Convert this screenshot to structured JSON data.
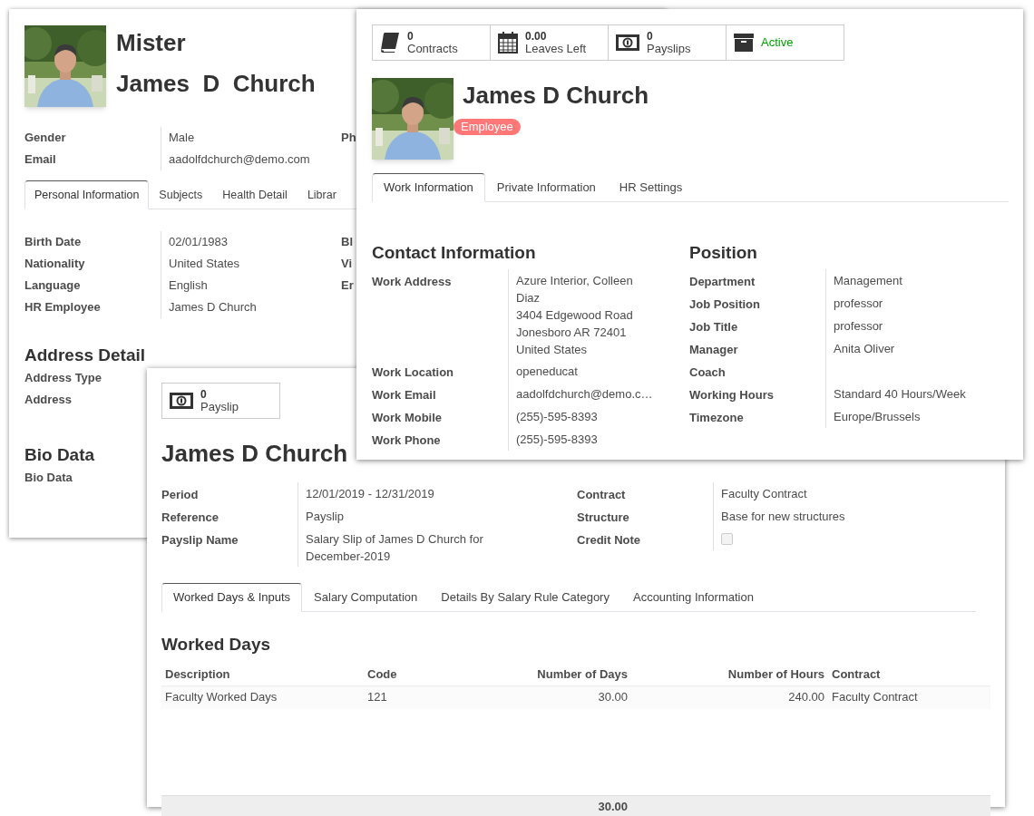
{
  "profile_window": {
    "salutation": "Mister",
    "name": "James  D  Church",
    "fields": [
      {
        "label": "Gender",
        "value": "Male"
      },
      {
        "label": "Email",
        "value": "aadolfdchurch@demo.com"
      }
    ],
    "fields_right": [
      "Ph"
    ],
    "tabs": [
      {
        "label": "Personal Information",
        "selected": true
      },
      {
        "label": "Subjects",
        "selected": false
      },
      {
        "label": "Health Detail",
        "selected": false
      },
      {
        "label": "Librar",
        "selected": false
      }
    ],
    "personal_fields": [
      {
        "label": "Birth Date",
        "value": "02/01/1983"
      },
      {
        "label": "Nationality",
        "value": "United States"
      },
      {
        "label": "Language",
        "value": "English"
      },
      {
        "label": "HR Employee",
        "value": "James D Church"
      }
    ],
    "personal_right": [
      "Bl",
      "Vi",
      "Er"
    ],
    "sections": [
      {
        "title": "Address Detail",
        "fields": [
          "Address Type",
          "Address"
        ]
      },
      {
        "title": "Bio Data",
        "fields": [
          "Bio Data"
        ]
      }
    ]
  },
  "employee_window": {
    "stats": [
      {
        "kind": "book",
        "value": "0",
        "label": "Contracts"
      },
      {
        "kind": "calendar",
        "value": "0.00",
        "label": "Leaves Left"
      },
      {
        "kind": "money",
        "value": "0",
        "label": "Payslips"
      },
      {
        "kind": "archive",
        "label": "Active"
      }
    ],
    "name": "James D Church",
    "badge": "Employee",
    "tabs": [
      {
        "label": "Work Information",
        "selected": true
      },
      {
        "label": "Private Information",
        "selected": false
      },
      {
        "label": "HR Settings",
        "selected": false
      }
    ],
    "contact": {
      "title": "Contact Information",
      "fields": [
        {
          "label": "Work Address",
          "lines": [
            "Azure Interior, Colleen Diaz",
            "3404 Edgewood Road",
            "Jonesboro AR 72401",
            "United States"
          ]
        },
        {
          "label": "Work Location",
          "lines": [
            "openeducat"
          ]
        },
        {
          "label": "Work Email",
          "lines": [
            "aadolfdchurch@demo.c…"
          ]
        },
        {
          "label": "Work Mobile",
          "lines": [
            "(255)-595-8393"
          ]
        },
        {
          "label": "Work Phone",
          "lines": [
            "(255)-595-8393"
          ]
        }
      ]
    },
    "position": {
      "title": "Position",
      "fields": [
        {
          "label": "Department",
          "lines": [
            "Management"
          ]
        },
        {
          "label": "Job Position",
          "lines": [
            "professor"
          ]
        },
        {
          "label": "Job Title",
          "lines": [
            "professor"
          ]
        },
        {
          "label": "Manager",
          "lines": [
            "Anita Oliver"
          ]
        },
        {
          "label": "Coach"
        },
        {
          "label": "Working Hours",
          "lines": [
            "Standard 40 Hours/Week"
          ]
        },
        {
          "label": "Timezone",
          "lines": [
            "Europe/Brussels"
          ]
        }
      ]
    }
  },
  "payslip_window": {
    "stat": {
      "value": "0",
      "label": "Payslip"
    },
    "name": "James D Church",
    "fields_left": [
      {
        "label": "Period",
        "value": "12/01/2019 - 12/31/2019"
      },
      {
        "label": "Reference",
        "value": "Payslip"
      },
      {
        "label": "Payslip Name",
        "value": "Salary Slip of James D Church for December-2019"
      }
    ],
    "fields_right": [
      {
        "kind": "text",
        "label": "Contract",
        "value": "Faculty Contract"
      },
      {
        "kind": "text",
        "label": "Structure",
        "value": "Base for new structures"
      },
      {
        "kind": "checkbox",
        "label": "Credit Note",
        "checked": false
      }
    ],
    "tabs": [
      {
        "label": "Worked Days & Inputs",
        "selected": true
      },
      {
        "label": "Salary Computation",
        "selected": false
      },
      {
        "label": "Details By Salary Rule Category",
        "selected": false
      },
      {
        "label": "Accounting Information",
        "selected": false
      }
    ],
    "worked_days": {
      "title": "Worked Days",
      "columns": [
        "Description",
        "Code",
        "Number of Days",
        "Number of Hours",
        "Contract"
      ],
      "rows": [
        [
          "Faculty Worked Days",
          "121",
          "30.00",
          "240.00",
          "Faculty Contract"
        ]
      ],
      "footer": "30.00"
    }
  }
}
